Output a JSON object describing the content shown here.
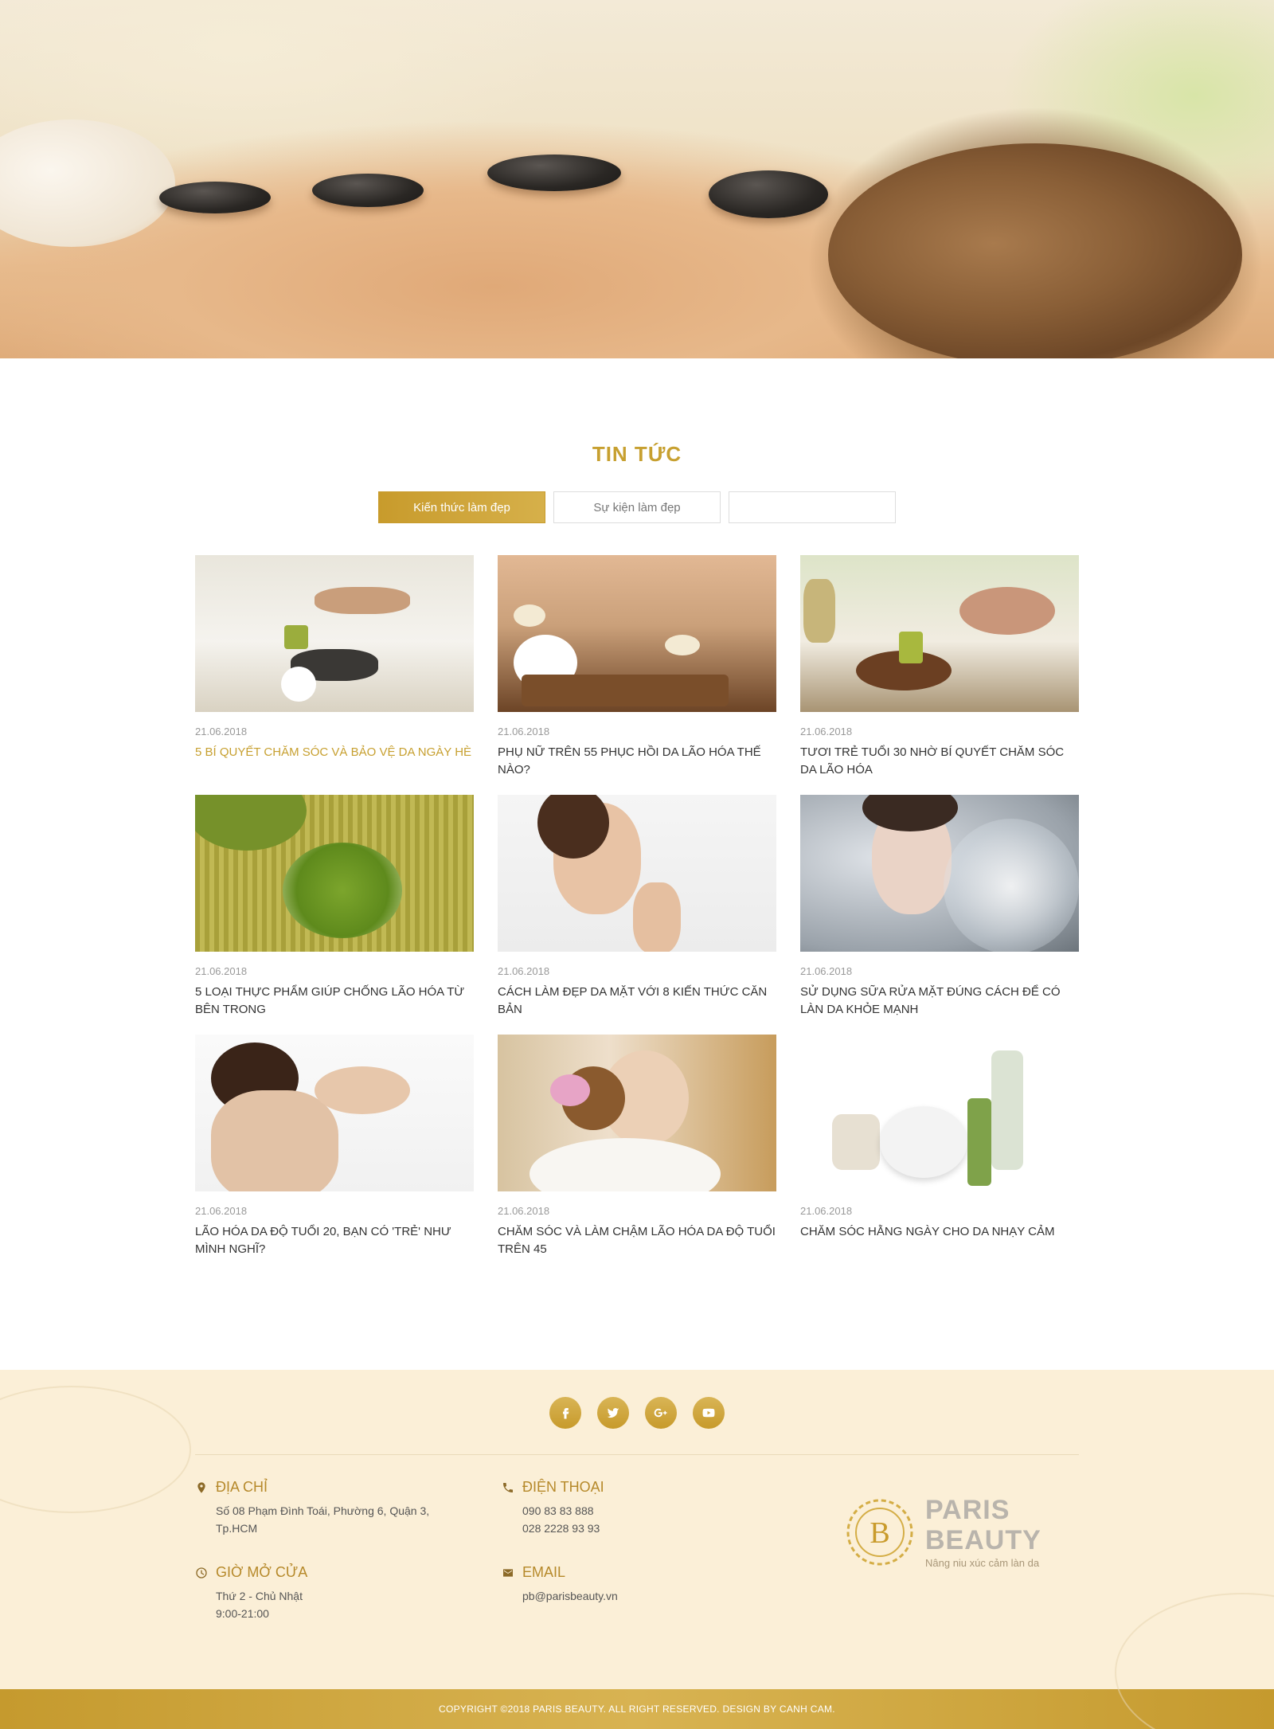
{
  "news": {
    "title": "TIN TỨC",
    "tabs": [
      {
        "label": "Kiến thức làm đẹp",
        "active": true
      },
      {
        "label": "Sự kiện làm đẹp",
        "active": false
      },
      {
        "label": "",
        "active": false
      }
    ],
    "articles": [
      {
        "date": "21.06.2018",
        "title": "5 BÍ QUYẾT CHĂM SÓC VÀ BẢO VỆ DA NGÀY HÈ"
      },
      {
        "date": "21.06.2018",
        "title": "PHỤ NỮ TRÊN 55 PHỤC HỒI DA LÃO HÓA THẾ NÀO?"
      },
      {
        "date": "21.06.2018",
        "title": "TƯƠI TRẺ TUỔI 30 NHỜ BÍ QUYẾT CHĂM SÓC DA LÃO HÓA"
      },
      {
        "date": "21.06.2018",
        "title": "5 LOẠI THỰC PHẨM GIÚP CHỐNG LÃO HÓA TỪ BÊN TRONG"
      },
      {
        "date": "21.06.2018",
        "title": "CÁCH LÀM ĐẸP DA MẶT VỚI 8 KIẾN THỨC CĂN BẢN"
      },
      {
        "date": "21.06.2018",
        "title": "SỬ DỤNG SỮA RỬA MẶT ĐÚNG CÁCH ĐỂ CÓ LÀN DA KHỎE MẠNH"
      },
      {
        "date": "21.06.2018",
        "title": "LÃO HÓA DA ĐỘ TUỔI 20, BẠN CÓ 'TRẺ' NHƯ MÌNH NGHĨ?"
      },
      {
        "date": "21.06.2018",
        "title": "CHĂM SÓC VÀ LÀM CHẬM LÃO HÓA DA ĐỘ TUỔI TRÊN 45"
      },
      {
        "date": "21.06.2018",
        "title": "CHĂM SÓC HẰNG NGÀY CHO DA NHẠY CẢM"
      }
    ]
  },
  "footer": {
    "social": [
      "facebook-icon",
      "twitter-icon",
      "google-plus-icon",
      "youtube-icon"
    ],
    "address": {
      "heading": "ĐỊA CHỈ",
      "lines": [
        "Số 08 Phạm Đình Toái, Phường 6, Quận 3,",
        "Tp.HCM"
      ]
    },
    "hours": {
      "heading": "GIỜ MỞ CỬA",
      "lines": [
        "Thứ 2 - Chủ Nhật",
        "9:00-21:00"
      ]
    },
    "phone": {
      "heading": "ĐIỆN THOẠI",
      "lines": [
        "090 83 83 888",
        "028 2228 93 93"
      ]
    },
    "email": {
      "heading": "EMAIL",
      "lines": [
        "pb@parisbeauty.vn"
      ]
    },
    "logo": {
      "letter": "B",
      "name_line1": "PARIS",
      "name_line2": "BEAUTY",
      "tagline": "Nâng niu xúc cảm làn da"
    },
    "copyright": "COPYRIGHT ©2018 PARIS BEAUTY. ALL RIGHT RESERVED. DESIGN BY CANH CAM."
  },
  "colors": {
    "accent": "#c7a030",
    "footer_bg": "#fbefd7",
    "copyright_bg": "#c59a2e"
  }
}
